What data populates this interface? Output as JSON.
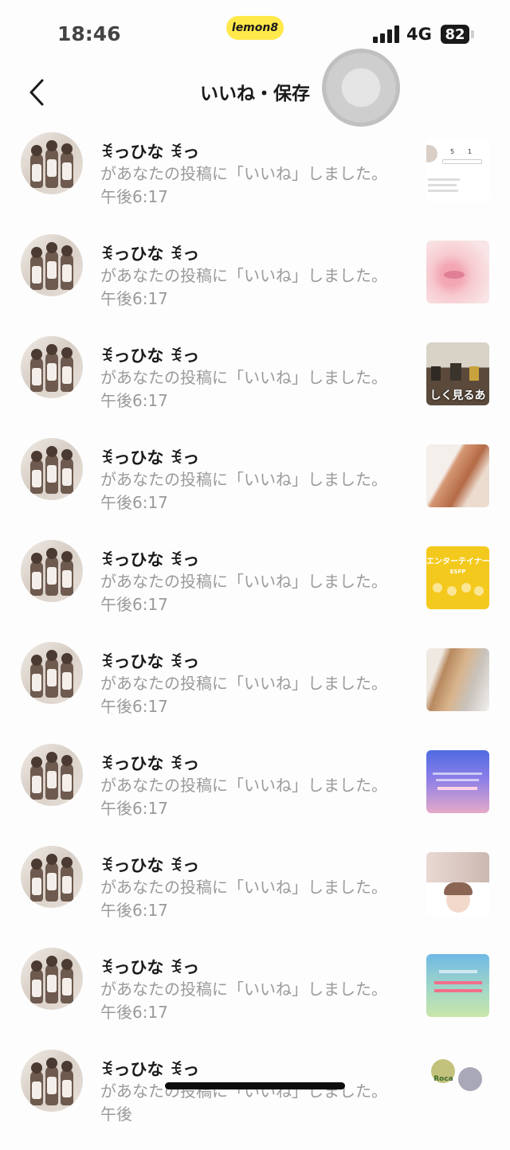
{
  "status_bar": {
    "time": "18:46",
    "app_logo": "lemon8",
    "network": "4G",
    "battery": "82",
    "icons": [
      "signal-icon",
      "battery-icon"
    ]
  },
  "nav": {
    "back_icon": "chevron-left-icon",
    "title": "いいね・保存"
  },
  "colors": {
    "background": "#fdfdfd",
    "primary_text": "#1a1a1a",
    "secondary_text": "#9a9a9a",
    "brand_yellow": "#ffe94a"
  },
  "notifications": [
    {
      "name": "ꉂっひな ꉂっ",
      "message": "があなたの投稿に「いいね」しました。 午後6:17",
      "thumb": "profile-card"
    },
    {
      "name": "ꉂっひな ꉂっ",
      "message": "があなたの投稿に「いいね」しました。 午後6:17",
      "thumb": "pink-closeup"
    },
    {
      "name": "ꉂっひな ꉂっ",
      "message": "があなたの投稿に「いいね」しました。 午後6:17",
      "thumb": "classroom",
      "thumb_text": "しく見るあ"
    },
    {
      "name": "ꉂっひな ꉂっ",
      "message": "があなたの投稿に「いいね」しました。 午後6:17",
      "thumb": "hair-closeup"
    },
    {
      "name": "ꉂっひな ꉂっ",
      "message": "があなたの投稿に「いいね」しました。 午後6:17",
      "thumb": "yellow-card",
      "thumb_text": "エンターテイナー",
      "thumb_sub": "ESFP"
    },
    {
      "name": "ꉂっひな ꉂっ",
      "message": "があなたの投稿に「いいね」しました。 午後6:17",
      "thumb": "hair-styling"
    },
    {
      "name": "ꉂっひな ꉂっ",
      "message": "があなたの投稿に「いいね」しました。 午後6:17",
      "thumb": "purple-gradient"
    },
    {
      "name": "ꉂっひな ꉂっ",
      "message": "があなたの投稿に「いいね」しました。 午後6:17",
      "thumb": "anime-portrait"
    },
    {
      "name": "ꉂっひな ꉂっ",
      "message": "があなたの投稿に「いいね」しました。 午後6:17",
      "thumb": "blue-green-card"
    },
    {
      "name": "ꉂっひな ꉂっ",
      "message": "があなたの投稿に「いいね」しました。 午後",
      "thumb": "anime-characters",
      "thumb_text": "Roca"
    }
  ]
}
